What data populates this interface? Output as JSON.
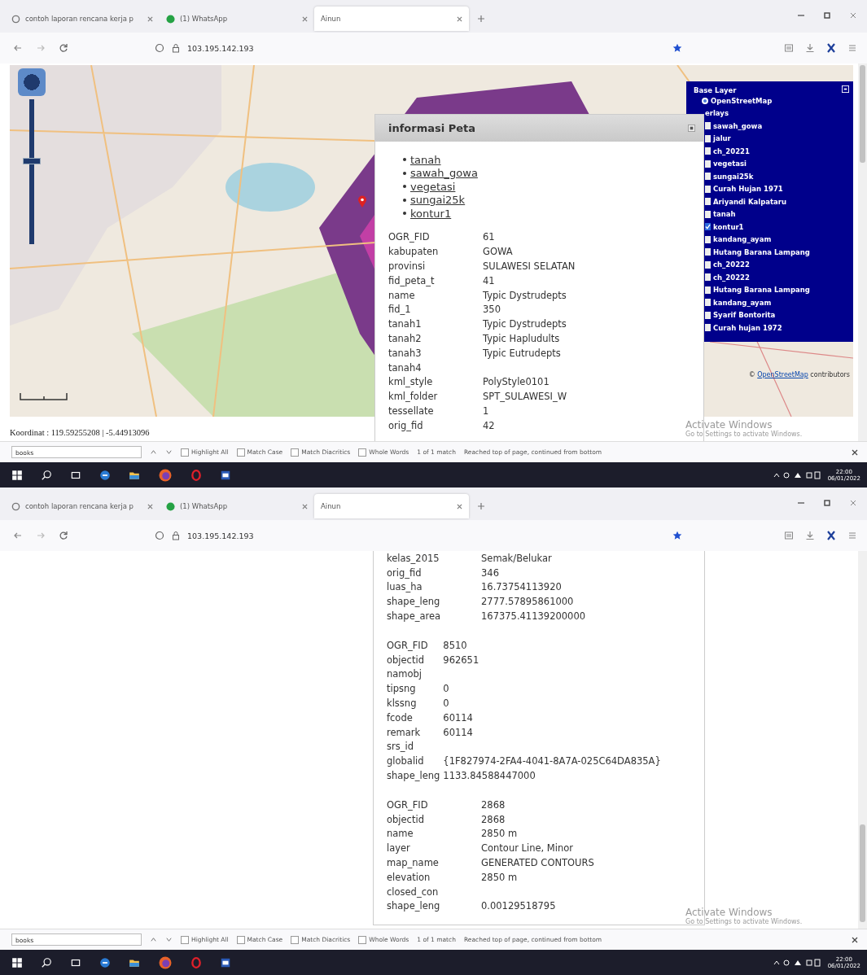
{
  "screenshots": [
    {
      "browser": {
        "tabs": [
          {
            "title": "contoh laporan rencana kerja p",
            "selected": false,
            "kind": "search"
          },
          {
            "title": "(1) WhatsApp",
            "selected": false,
            "kind": "chat"
          },
          {
            "title": "Ainun",
            "selected": true,
            "kind": "page"
          }
        ],
        "url": "103.195.142.193"
      },
      "page": {
        "kind": "map",
        "zoom": {
          "level": 0.55
        },
        "layer_switcher": {
          "base_title": "Base Layer",
          "base_layers": [
            {
              "label": "OpenStreetMap",
              "selected": true
            }
          ],
          "overlays_title": "erlays",
          "overlays": [
            {
              "label": "sawah_gowa",
              "checked": false
            },
            {
              "label": "jalur",
              "checked": false
            },
            {
              "label": "ch_20221",
              "checked": false
            },
            {
              "label": "vegetasi",
              "checked": false
            },
            {
              "label": "sungai25k",
              "checked": false
            },
            {
              "label": "Curah Hujan 1971",
              "checked": false
            },
            {
              "label": "Ariyandi Kalpataru",
              "checked": false
            },
            {
              "label": "tanah",
              "checked": false
            },
            {
              "label": "kontur1",
              "checked": true
            },
            {
              "label": "kandang_ayam",
              "checked": false
            },
            {
              "label": "Hutang Barana Lampang",
              "checked": false
            },
            {
              "label": "ch_20222",
              "checked": false
            },
            {
              "label": "ch_20222",
              "checked": false
            },
            {
              "label": "Hutang Barana Lampang",
              "checked": false
            },
            {
              "label": "kandang_ayam",
              "checked": false
            },
            {
              "label": "Syarif Bontorita",
              "checked": false
            },
            {
              "label": "Curah hujan 1972",
              "checked": false
            }
          ]
        },
        "attribution": {
          "prefix": "©",
          "link": "OpenStreetMap",
          "suffix": "contributors"
        },
        "coordinates": "Koordinat : 119.59255208 | -5.44913096",
        "popup": {
          "title": "informasi Peta",
          "links": [
            "tanah",
            "sawah_gowa",
            "vegetasi",
            "sungai25k",
            "kontur1"
          ],
          "groups": [
            {
              "rows": [
                {
                  "key": "OGR_FID",
                  "value": "61"
                },
                {
                  "key": "kabupaten",
                  "value": "GOWA"
                },
                {
                  "key": "provinsi",
                  "value": "SULAWESI SELATAN"
                },
                {
                  "key": "fid_peta_t",
                  "value": "41"
                },
                {
                  "key": "name",
                  "value": "Typic Dystrudepts"
                },
                {
                  "key": "fid_1",
                  "value": "350"
                },
                {
                  "key": "tanah1",
                  "value": "Typic Dystrudepts"
                },
                {
                  "key": "tanah2",
                  "value": "Typic Hapludults"
                },
                {
                  "key": "tanah3",
                  "value": "Typic Eutrudepts"
                },
                {
                  "key": "tanah4"
                },
                {
                  "key": "kml_style",
                  "value": "PolyStyle0101"
                },
                {
                  "key": "kml_folder",
                  "value": "SPT_SULAWESI_W"
                },
                {
                  "key": "tessellate",
                  "value": "1"
                },
                {
                  "key": "orig_fid",
                  "value": "42"
                }
              ]
            }
          ]
        }
      },
      "activation": {
        "title": "Activate Windows",
        "detail": "Go to Settings to activate Windows."
      },
      "find_bar": {
        "query": "books",
        "options": [
          {
            "label": "Highlight All",
            "checked": false
          },
          {
            "label": "Match Case",
            "checked": false
          },
          {
            "label": "Match Diacritics",
            "checked": false
          },
          {
            "label": "Whole Words",
            "checked": false
          }
        ],
        "result": "1 of 1 match",
        "message": "Reached top of page, continued from bottom"
      },
      "taskbar": {
        "time": "22:00",
        "date": "06/01/2022"
      }
    },
    {
      "browser": {
        "tabs": [
          {
            "title": "contoh laporan rencana kerja p",
            "selected": false,
            "kind": "search"
          },
          {
            "title": "(1) WhatsApp",
            "selected": false,
            "kind": "chat"
          },
          {
            "title": "Ainun",
            "selected": true,
            "kind": "page"
          }
        ],
        "url": "103.195.142.193"
      },
      "page": {
        "kind": "scrolled_popup",
        "popup": {
          "groups": [
            {
              "rows": [
                {
                  "key": "kelas_2015",
                  "value": "Semak/Belukar"
                },
                {
                  "key": "orig_fid",
                  "value": "346"
                },
                {
                  "key": "luas_ha",
                  "value": "16.73754113920"
                },
                {
                  "key": "shape_leng",
                  "value": "2777.57895861000"
                },
                {
                  "key": "shape_area",
                  "value": "167375.41139200000"
                }
              ]
            },
            {
              "rows": [
                {
                  "key": "OGR_FID",
                  "value": "8510"
                },
                {
                  "key": "objectid",
                  "value": "962651"
                },
                {
                  "key": "namobj"
                },
                {
                  "key": "tipsng",
                  "value": "0"
                },
                {
                  "key": "klssng",
                  "value": "0"
                },
                {
                  "key": "fcode",
                  "value": "60114"
                },
                {
                  "key": "remark",
                  "value": "60114"
                },
                {
                  "key": "srs_id"
                },
                {
                  "key": "globalid",
                  "value": "{1F827974-2FA4-4041-8A7A-025C64DA835A}"
                },
                {
                  "key": "shape_leng",
                  "value": "1133.84588447000"
                }
              ]
            },
            {
              "rows": [
                {
                  "key": "OGR_FID",
                  "value": "2868"
                },
                {
                  "key": "objectid",
                  "value": "2868"
                },
                {
                  "key": "name",
                  "value": "2850 m"
                },
                {
                  "key": "layer",
                  "value": "Contour Line, Minor"
                },
                {
                  "key": "map_name",
                  "value": "GENERATED CONTOURS"
                },
                {
                  "key": "elevation",
                  "value": "2850 m"
                },
                {
                  "key": "closed_con"
                },
                {
                  "key": "shape_leng",
                  "value": "0.00129518795"
                }
              ]
            }
          ]
        }
      },
      "activation": {
        "title": "Activate Windows",
        "detail": "Go to Settings to activate Windows."
      },
      "find_bar": {
        "query": "books",
        "options": [
          {
            "label": "Highlight All",
            "checked": false
          },
          {
            "label": "Match Case",
            "checked": false
          },
          {
            "label": "Match Diacritics",
            "checked": false
          },
          {
            "label": "Whole Words",
            "checked": false
          }
        ],
        "result": "1 of 1 match",
        "message": "Reached top of page, continued from bottom"
      },
      "taskbar": {
        "time": "22:00",
        "date": "06/01/2022"
      }
    }
  ]
}
